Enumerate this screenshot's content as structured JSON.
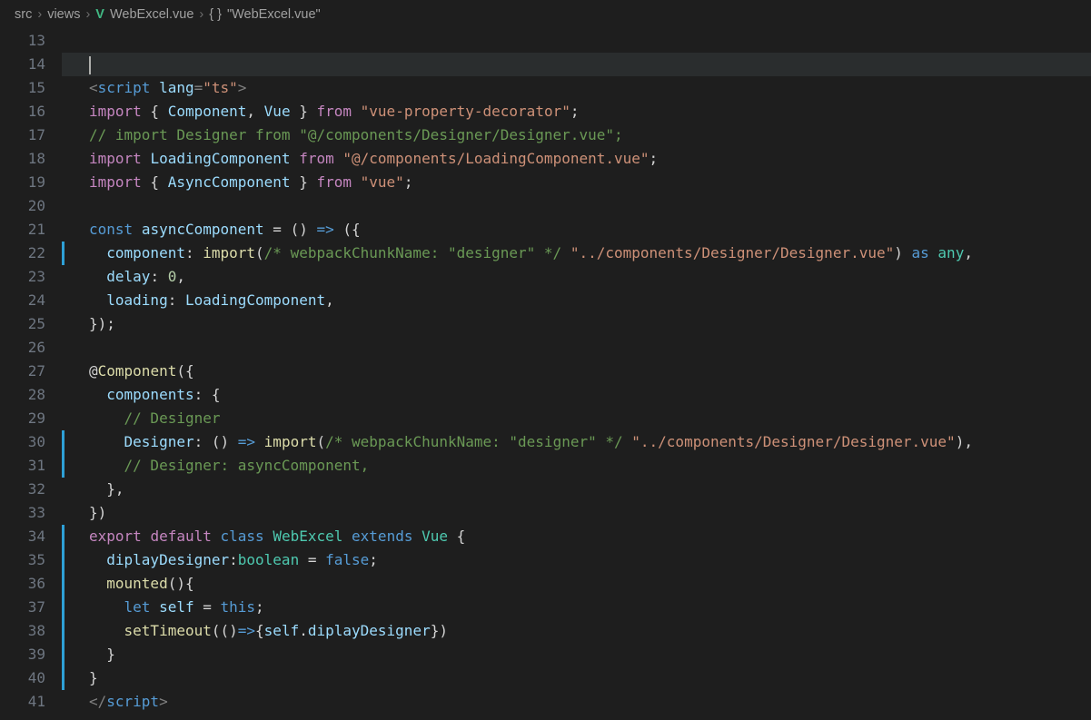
{
  "breadcrumbs": {
    "items": [
      "src",
      "views",
      "WebExcel.vue",
      "\"WebExcel.vue\""
    ],
    "vue_icon": "V",
    "brace_icon": "{ }"
  },
  "editor": {
    "first_line_number": 13,
    "highlighted_line_index": 1,
    "modified_line_indices": [
      9,
      17,
      18,
      21,
      22,
      23,
      24,
      25,
      26,
      27
    ],
    "lines": [
      [],
      [
        {
          "c": "cursor"
        }
      ],
      [
        {
          "c": "p-punct",
          "t": "<"
        },
        {
          "c": "p-tag",
          "t": "script"
        },
        {
          "c": "p-plain",
          "t": " "
        },
        {
          "c": "p-attr",
          "t": "lang"
        },
        {
          "c": "p-punct",
          "t": "="
        },
        {
          "c": "p-str",
          "t": "\"ts\""
        },
        {
          "c": "p-punct",
          "t": ">"
        }
      ],
      [
        {
          "c": "p-kw",
          "t": "import"
        },
        {
          "c": "p-plain",
          "t": " { "
        },
        {
          "c": "p-var",
          "t": "Component"
        },
        {
          "c": "p-plain",
          "t": ", "
        },
        {
          "c": "p-var",
          "t": "Vue"
        },
        {
          "c": "p-plain",
          "t": " } "
        },
        {
          "c": "p-kw",
          "t": "from"
        },
        {
          "c": "p-plain",
          "t": " "
        },
        {
          "c": "p-str",
          "t": "\"vue-property-decorator\""
        },
        {
          "c": "p-plain",
          "t": ";"
        }
      ],
      [
        {
          "c": "p-comment",
          "t": "// import Designer from \"@/components/Designer/Designer.vue\";"
        }
      ],
      [
        {
          "c": "p-kw",
          "t": "import"
        },
        {
          "c": "p-plain",
          "t": " "
        },
        {
          "c": "p-var",
          "t": "LoadingComponent"
        },
        {
          "c": "p-plain",
          "t": " "
        },
        {
          "c": "p-kw",
          "t": "from"
        },
        {
          "c": "p-plain",
          "t": " "
        },
        {
          "c": "p-str",
          "t": "\"@/components/LoadingComponent.vue\""
        },
        {
          "c": "p-plain",
          "t": ";"
        }
      ],
      [
        {
          "c": "p-kw",
          "t": "import"
        },
        {
          "c": "p-plain",
          "t": " { "
        },
        {
          "c": "p-var",
          "t": "AsyncComponent"
        },
        {
          "c": "p-plain",
          "t": " } "
        },
        {
          "c": "p-kw",
          "t": "from"
        },
        {
          "c": "p-plain",
          "t": " "
        },
        {
          "c": "p-str",
          "t": "\"vue\""
        },
        {
          "c": "p-plain",
          "t": ";"
        }
      ],
      [],
      [
        {
          "c": "p-kw2",
          "t": "const"
        },
        {
          "c": "p-plain",
          "t": " "
        },
        {
          "c": "p-var",
          "t": "asyncComponent"
        },
        {
          "c": "p-plain",
          "t": " = () "
        },
        {
          "c": "p-kw2",
          "t": "=>"
        },
        {
          "c": "p-plain",
          "t": " ({"
        }
      ],
      [
        {
          "c": "p-plain",
          "t": "  "
        },
        {
          "c": "p-prop",
          "t": "component"
        },
        {
          "c": "p-plain",
          "t": ": "
        },
        {
          "c": "p-fn",
          "t": "import"
        },
        {
          "c": "p-plain",
          "t": "("
        },
        {
          "c": "p-comment",
          "t": "/* webpackChunkName: \"designer\" */"
        },
        {
          "c": "p-plain",
          "t": " "
        },
        {
          "c": "p-str",
          "t": "\"../components/Designer/Designer.vue\""
        },
        {
          "c": "p-plain",
          "t": ") "
        },
        {
          "c": "p-kw2",
          "t": "as"
        },
        {
          "c": "p-plain",
          "t": " "
        },
        {
          "c": "p-type",
          "t": "any"
        },
        {
          "c": "p-plain",
          "t": ","
        }
      ],
      [
        {
          "c": "p-plain",
          "t": "  "
        },
        {
          "c": "p-prop",
          "t": "delay"
        },
        {
          "c": "p-plain",
          "t": ": "
        },
        {
          "c": "p-num",
          "t": "0"
        },
        {
          "c": "p-plain",
          "t": ","
        }
      ],
      [
        {
          "c": "p-plain",
          "t": "  "
        },
        {
          "c": "p-prop",
          "t": "loading"
        },
        {
          "c": "p-plain",
          "t": ": "
        },
        {
          "c": "p-var",
          "t": "LoadingComponent"
        },
        {
          "c": "p-plain",
          "t": ","
        }
      ],
      [
        {
          "c": "p-plain",
          "t": "});"
        }
      ],
      [],
      [
        {
          "c": "p-plain",
          "t": "@"
        },
        {
          "c": "p-fn",
          "t": "Component"
        },
        {
          "c": "p-plain",
          "t": "({"
        }
      ],
      [
        {
          "c": "p-plain",
          "t": "  "
        },
        {
          "c": "p-prop",
          "t": "components"
        },
        {
          "c": "p-plain",
          "t": ": {"
        }
      ],
      [
        {
          "c": "p-plain",
          "t": "    "
        },
        {
          "c": "p-comment",
          "t": "// Designer"
        }
      ],
      [
        {
          "c": "p-plain",
          "t": "    "
        },
        {
          "c": "p-prop",
          "t": "Designer"
        },
        {
          "c": "p-plain",
          "t": ": () "
        },
        {
          "c": "p-kw2",
          "t": "=>"
        },
        {
          "c": "p-plain",
          "t": " "
        },
        {
          "c": "p-fn",
          "t": "import"
        },
        {
          "c": "p-plain",
          "t": "("
        },
        {
          "c": "p-comment",
          "t": "/* webpackChunkName: \"designer\" */"
        },
        {
          "c": "p-plain",
          "t": " "
        },
        {
          "c": "p-str",
          "t": "\"../components/Designer/Designer.vue\""
        },
        {
          "c": "p-plain",
          "t": "),"
        }
      ],
      [
        {
          "c": "p-plain",
          "t": "    "
        },
        {
          "c": "p-comment",
          "t": "// Designer: asyncComponent,"
        }
      ],
      [
        {
          "c": "p-plain",
          "t": "  },"
        }
      ],
      [
        {
          "c": "p-plain",
          "t": "})"
        }
      ],
      [
        {
          "c": "p-kw",
          "t": "export"
        },
        {
          "c": "p-plain",
          "t": " "
        },
        {
          "c": "p-kw",
          "t": "default"
        },
        {
          "c": "p-plain",
          "t": " "
        },
        {
          "c": "p-kw2",
          "t": "class"
        },
        {
          "c": "p-plain",
          "t": " "
        },
        {
          "c": "p-type",
          "t": "WebExcel"
        },
        {
          "c": "p-plain",
          "t": " "
        },
        {
          "c": "p-kw2",
          "t": "extends"
        },
        {
          "c": "p-plain",
          "t": " "
        },
        {
          "c": "p-type",
          "t": "Vue"
        },
        {
          "c": "p-plain",
          "t": " {"
        }
      ],
      [
        {
          "c": "p-plain",
          "t": "  "
        },
        {
          "c": "p-prop",
          "t": "diplayDesigner"
        },
        {
          "c": "p-plain",
          "t": ":"
        },
        {
          "c": "p-type",
          "t": "boolean"
        },
        {
          "c": "p-plain",
          "t": " = "
        },
        {
          "c": "p-bool",
          "t": "false"
        },
        {
          "c": "p-plain",
          "t": ";"
        }
      ],
      [
        {
          "c": "p-plain",
          "t": "  "
        },
        {
          "c": "p-fn",
          "t": "mounted"
        },
        {
          "c": "p-plain",
          "t": "(){"
        }
      ],
      [
        {
          "c": "p-plain",
          "t": "    "
        },
        {
          "c": "p-kw2",
          "t": "let"
        },
        {
          "c": "p-plain",
          "t": " "
        },
        {
          "c": "p-var",
          "t": "self"
        },
        {
          "c": "p-plain",
          "t": " = "
        },
        {
          "c": "p-kw2",
          "t": "this"
        },
        {
          "c": "p-plain",
          "t": ";"
        }
      ],
      [
        {
          "c": "p-plain",
          "t": "    "
        },
        {
          "c": "p-fn",
          "t": "setTimeout"
        },
        {
          "c": "p-plain",
          "t": "(()"
        },
        {
          "c": "p-kw2",
          "t": "=>"
        },
        {
          "c": "p-plain",
          "t": "{"
        },
        {
          "c": "p-var",
          "t": "self"
        },
        {
          "c": "p-plain",
          "t": "."
        },
        {
          "c": "p-prop",
          "t": "diplayDesigner"
        },
        {
          "c": "p-plain",
          "t": "})"
        }
      ],
      [
        {
          "c": "p-plain",
          "t": "  }"
        }
      ],
      [
        {
          "c": "p-plain",
          "t": "}"
        }
      ],
      [
        {
          "c": "p-punct",
          "t": "</"
        },
        {
          "c": "p-tag",
          "t": "script"
        },
        {
          "c": "p-punct",
          "t": ">"
        }
      ]
    ]
  }
}
